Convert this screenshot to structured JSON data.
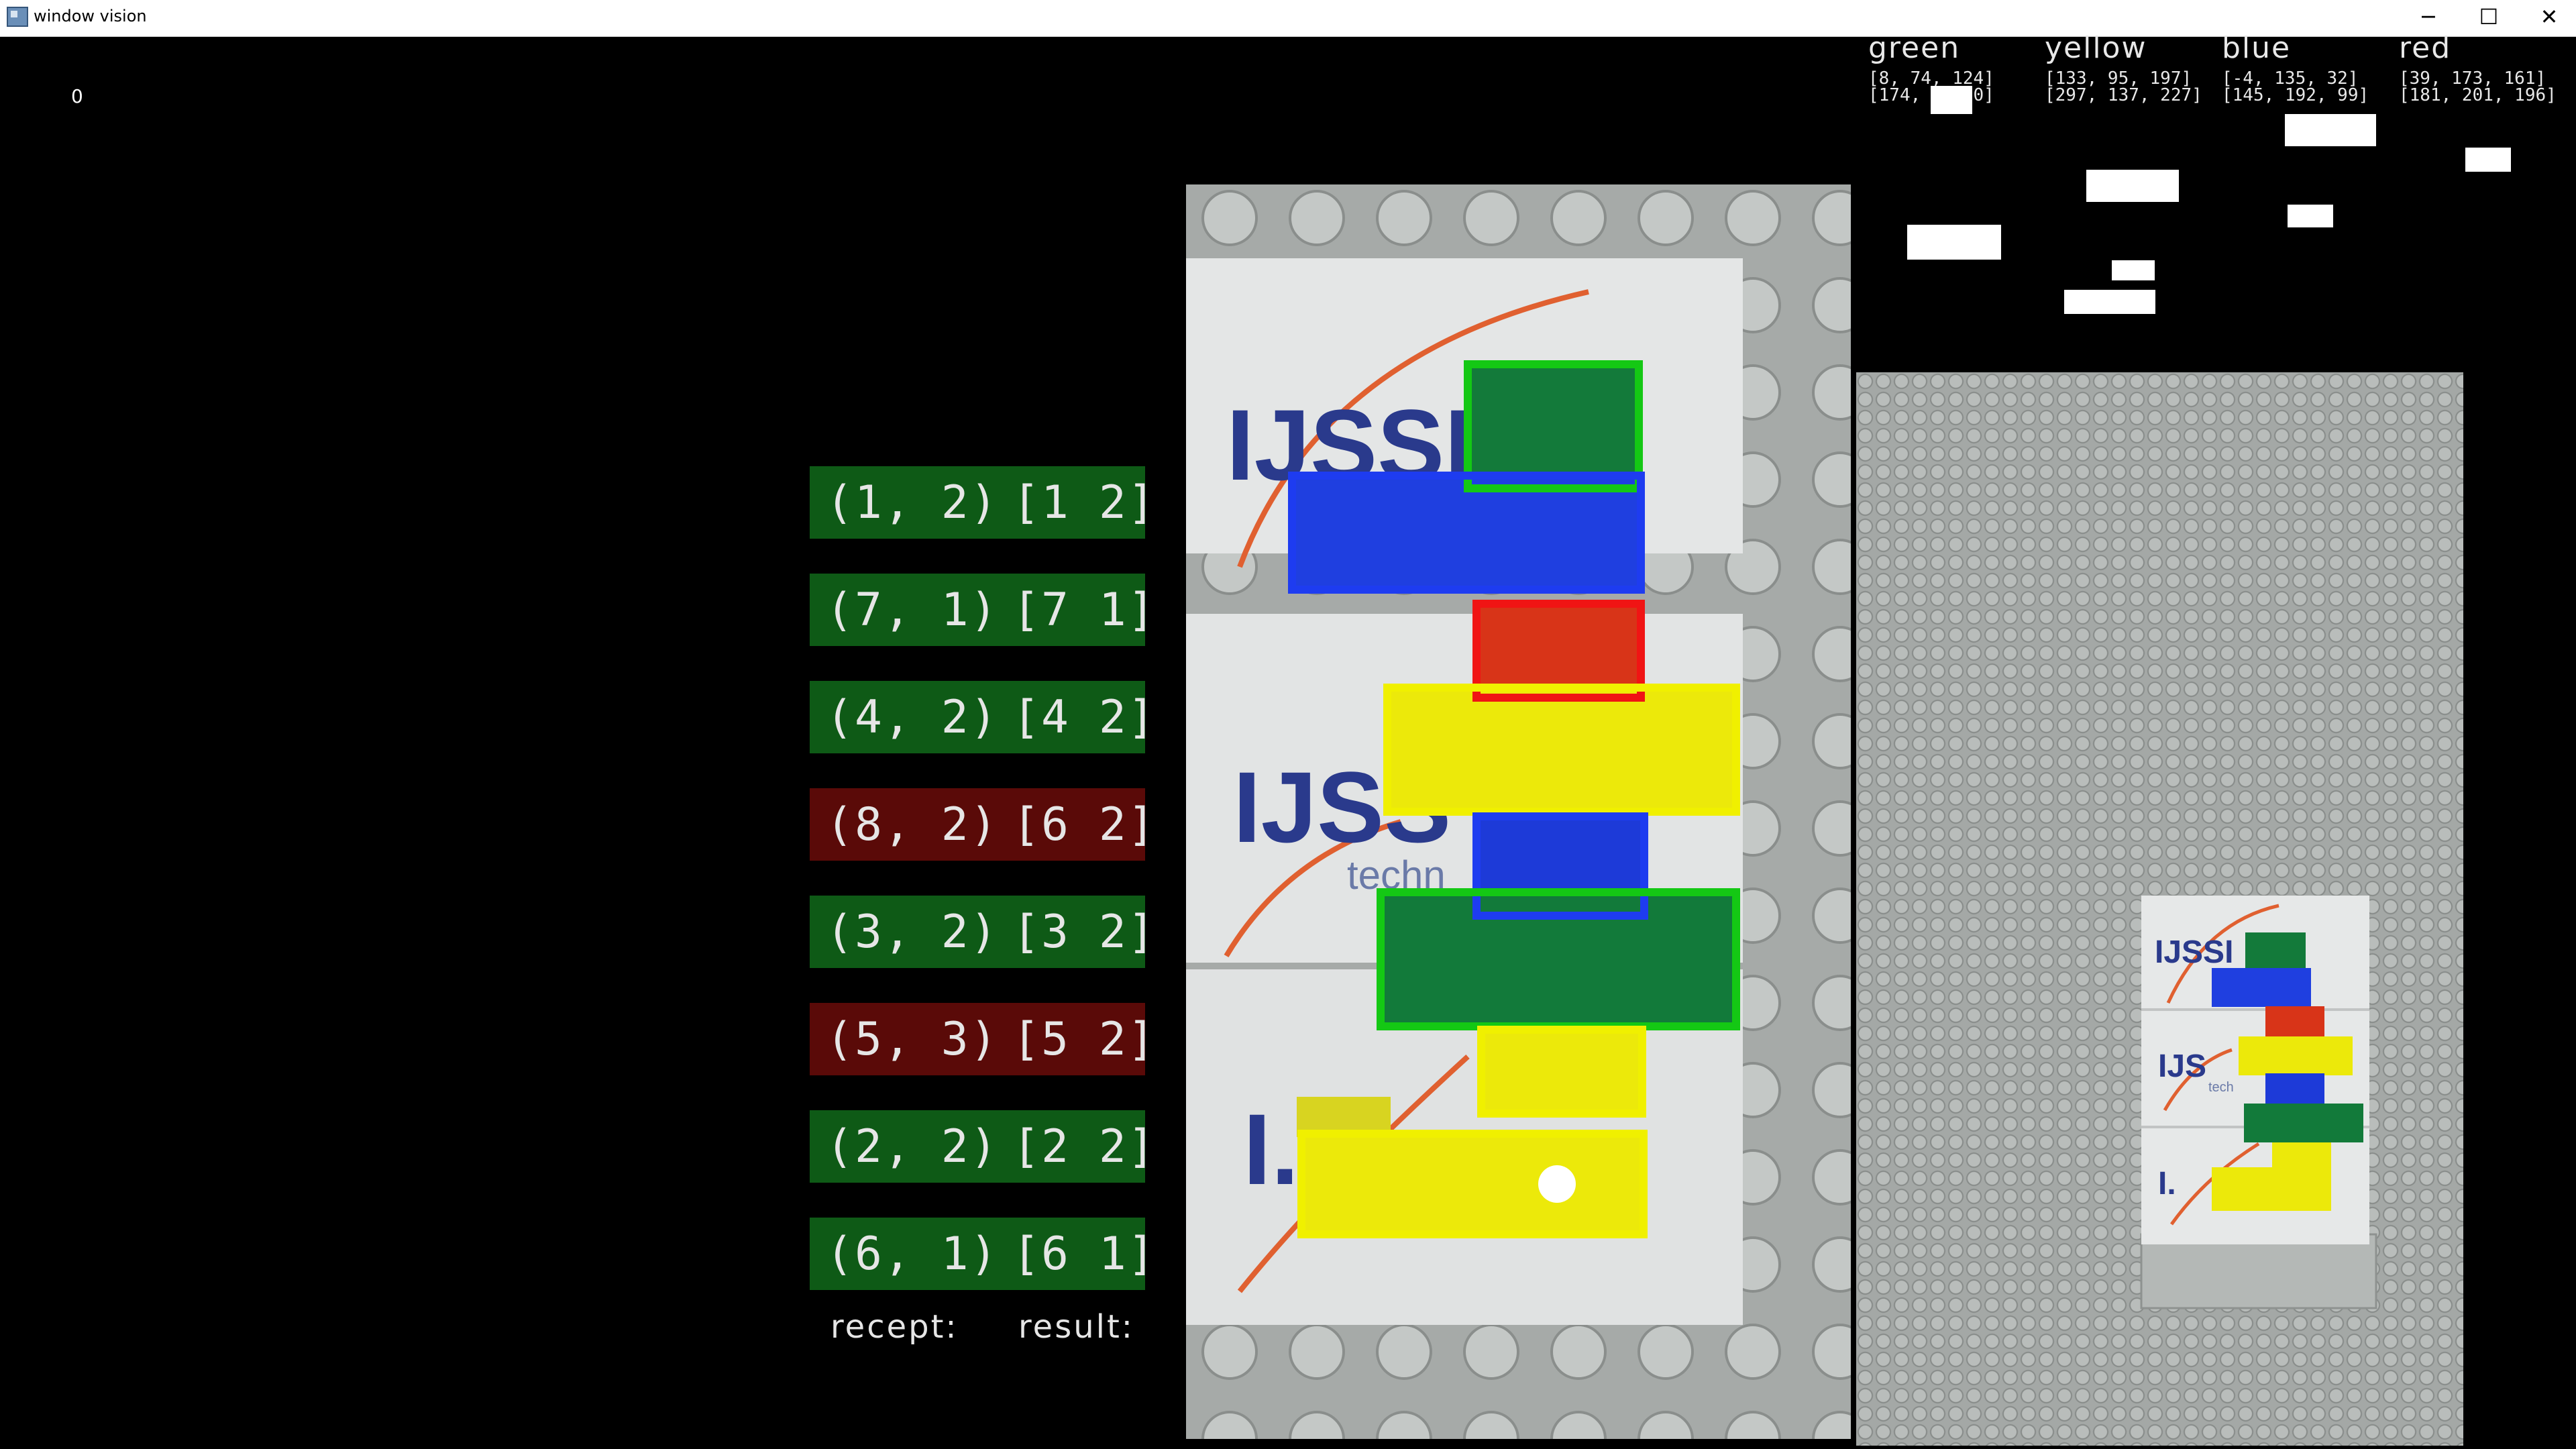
{
  "window": {
    "title": "window vision",
    "controls": {
      "minimize": "─",
      "maximize": "☐",
      "close": "✕"
    }
  },
  "frame_counter": "0",
  "thresholds": [
    {
      "name": "green",
      "low": "[8, 74, 124]",
      "high": "[174, 1  70]"
    },
    {
      "name": "yellow",
      "low": "[133, 95, 197]",
      "high": "[297, 137, 227]"
    },
    {
      "name": "blue",
      "low": "[-4, 135, 32]",
      "high": "[145, 192, 99]"
    },
    {
      "name": "red",
      "low": "[39, 173, 161]",
      "high": "[181, 201, 196]"
    }
  ],
  "table": {
    "rows": [
      {
        "recept": "(1, 2)",
        "result": "[1 2]",
        "status": "ok"
      },
      {
        "recept": "(7, 1)",
        "result": "[7 1]",
        "status": "ok"
      },
      {
        "recept": "(4, 2)",
        "result": "[4 2]",
        "status": "ok"
      },
      {
        "recept": "(8, 2)",
        "result": "[6 2]",
        "status": "bad"
      },
      {
        "recept": "(3, 2)",
        "result": "[3 2]",
        "status": "ok"
      },
      {
        "recept": "(5, 3)",
        "result": "[5 2]",
        "status": "bad"
      },
      {
        "recept": "(2, 2)",
        "result": "[2 2]",
        "status": "ok"
      },
      {
        "recept": "(6, 1)",
        "result": "[6 1]",
        "status": "ok"
      }
    ],
    "recept_label": "recept:",
    "result_label": "result:"
  },
  "camera_logo_text": [
    "IJSSE",
    "IJSS",
    "I."
  ],
  "camera_logo_sub": "techn",
  "board_logo_text": [
    "IJSSI",
    "IJS",
    "I."
  ],
  "board_logo_sub": "tech",
  "detections": [
    {
      "color": "green",
      "stroke": "#14c814"
    },
    {
      "color": "blue",
      "stroke": "#1e3cf0"
    },
    {
      "color": "red",
      "stroke": "#f01414"
    },
    {
      "color": "yellow",
      "stroke": "#f0f000"
    },
    {
      "color": "blue",
      "stroke": "#1e3cf0"
    },
    {
      "color": "green",
      "stroke": "#14c814"
    },
    {
      "color": "yellow",
      "stroke": "#f0f000"
    },
    {
      "color": "yellow",
      "stroke": "#f0f000"
    }
  ]
}
